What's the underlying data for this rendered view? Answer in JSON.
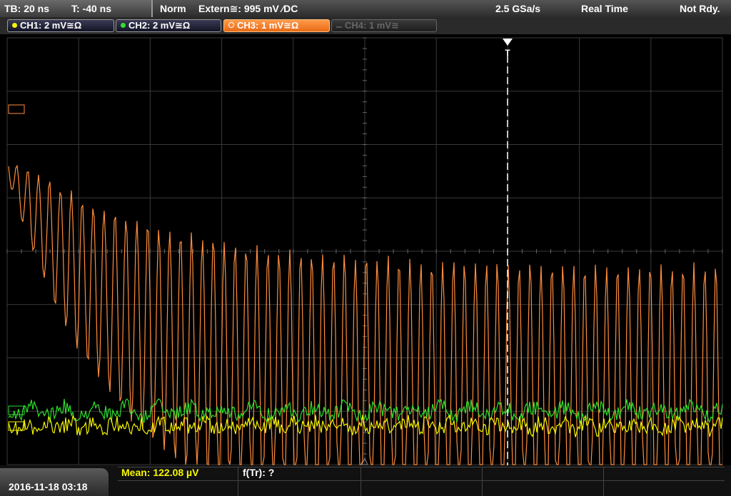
{
  "topbar": {
    "timebase": "TB: 20 ns",
    "trigger_time": "T: -40 ns",
    "trigger_mode": "Norm",
    "trigger_source": "Extern≅: 995 mV ∕DC",
    "sample_rate": "2.5 GSa/s",
    "acq_mode": "Real Time",
    "status": "Not Rdy."
  },
  "channels": [
    {
      "label": "CH1: 2 mV≅Ω",
      "color": "#f5f500",
      "state": "on"
    },
    {
      "label": "CH2: 2 mV≅Ω",
      "color": "#2ee02e",
      "state": "on"
    },
    {
      "label": "CH3: 1 mV≅Ω",
      "color": "#ff8c3c",
      "state": "active"
    },
    {
      "label": "CH4: 1 mV≅",
      "color": "#666666",
      "state": "off"
    }
  ],
  "trigger_marker": "T",
  "measurements": {
    "mean": "Mean: 122.08 µV",
    "ftr": "f(Tr): ?"
  },
  "datetime": "2016-11-18 03:18",
  "colors": {
    "ch1": "#f5f500",
    "ch2": "#2ee02e",
    "ch3": "#ff8c3c",
    "grid": "#3a3a3a"
  }
}
